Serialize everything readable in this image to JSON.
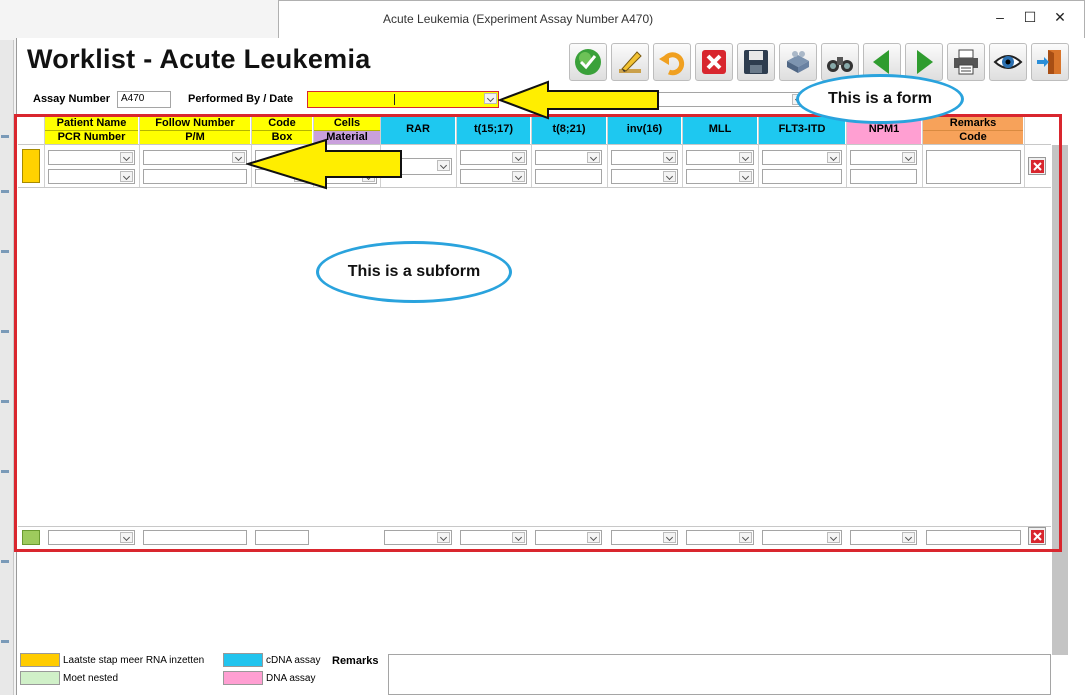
{
  "window": {
    "title": "Acute Leukemia  (Experiment Assay Number A470)",
    "minimize": "–",
    "maximize": "☐",
    "close": "✕"
  },
  "form": {
    "heading": "Worklist - Acute Leukemia",
    "assay_number_label": "Assay Number",
    "assay_number_value": "A470",
    "performed_label": "Performed By / Date"
  },
  "toolbar": [
    "check-icon",
    "pencil-icon",
    "undo-icon",
    "delete-icon",
    "save-icon",
    "machine-icon",
    "binoculars-icon",
    "arrow-left-icon",
    "arrow-right-icon",
    "printer-icon",
    "eye-icon",
    "exit-door-icon"
  ],
  "columns": [
    {
      "line1": "Patient Name",
      "line2": "PCR Number",
      "color": "#ffff00"
    },
    {
      "line1": "Follow Number",
      "line2": "P/M",
      "color": "#ffff00"
    },
    {
      "line1": "Code",
      "line2": "Box",
      "color": "#ffff00"
    },
    {
      "line1": "Cells",
      "line2": "Material",
      "color": "#ffff00",
      "color2": "#c9a0dc"
    },
    {
      "line1": "RAR",
      "line2": "",
      "color": "#1ec8f0"
    },
    {
      "line1": "t(15;17)",
      "line2": "",
      "color": "#1ec8f0"
    },
    {
      "line1": "t(8;21)",
      "line2": "",
      "color": "#1ec8f0"
    },
    {
      "line1": "inv(16)",
      "line2": "",
      "color": "#1ec8f0"
    },
    {
      "line1": "MLL",
      "line2": "",
      "color": "#1ec8f0"
    },
    {
      "line1": "FLT3-ITD",
      "line2": "",
      "color": "#1ec8f0"
    },
    {
      "line1": "NPM1",
      "line2": "",
      "color": "#ff9fd2"
    },
    {
      "line1": "Remarks",
      "line2": "Code",
      "color": "#f7a25a"
    }
  ],
  "row_colors": {
    "first": "#ffd200",
    "new": "#9ecb5d"
  },
  "annotations": {
    "form_label": "This is a form",
    "subform_label": "This is a subform",
    "arrow_color": "#ffee00",
    "ellipse_color": "#2aa3dd",
    "frame_color": "#d9262e"
  },
  "legend": [
    {
      "color": "#ffcc00",
      "label": "Laatste stap meer RNA inzetten"
    },
    {
      "color": "#d0f0c8",
      "label": "Moet nested"
    },
    {
      "color": "#22c4ee",
      "label": "cDNA assay"
    },
    {
      "color": "#ff9fd2",
      "label": "DNA assay"
    }
  ],
  "remarks_label": "Remarks"
}
